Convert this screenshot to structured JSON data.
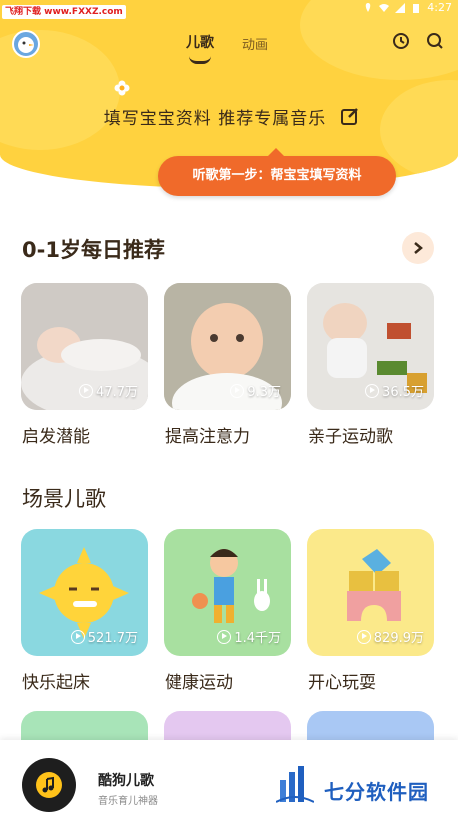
{
  "statusbar": {
    "badge": "飞翔下载 www.FXXZ.com",
    "time": "4:27"
  },
  "nav": {
    "tab_active": "儿歌",
    "tab_inactive": "动画"
  },
  "profile": {
    "prompt": "填写宝宝资料 推荐专属音乐",
    "tip": "听歌第一步：帮宝宝填写资料"
  },
  "section1": {
    "title": "0-1岁每日推荐",
    "items": [
      {
        "label": "启发潜能",
        "count": "47.7万"
      },
      {
        "label": "提高注意力",
        "count": "9.3万"
      },
      {
        "label": "亲子运动歌",
        "count": "36.5万"
      }
    ]
  },
  "section2": {
    "title": "场景儿歌",
    "items": [
      {
        "label": "快乐起床",
        "count": "521.7万",
        "color": "#8ad8e0"
      },
      {
        "label": "健康运动",
        "count": "1.4千万",
        "color": "#a8e0a0"
      },
      {
        "label": "开心玩耍",
        "count": "829.9万",
        "color": "#fbe98a"
      }
    ]
  },
  "row3_colors": [
    "#a8e4b8",
    "#e4c8f0",
    "#a9c8f4"
  ],
  "player": {
    "app_name": "酷狗儿歌",
    "app_sub": "音乐育儿神器"
  },
  "watermark": {
    "text": "七分软件园"
  },
  "colors": {
    "accent_yellow": "#ffd23f",
    "accent_orange": "#f06a2a"
  }
}
